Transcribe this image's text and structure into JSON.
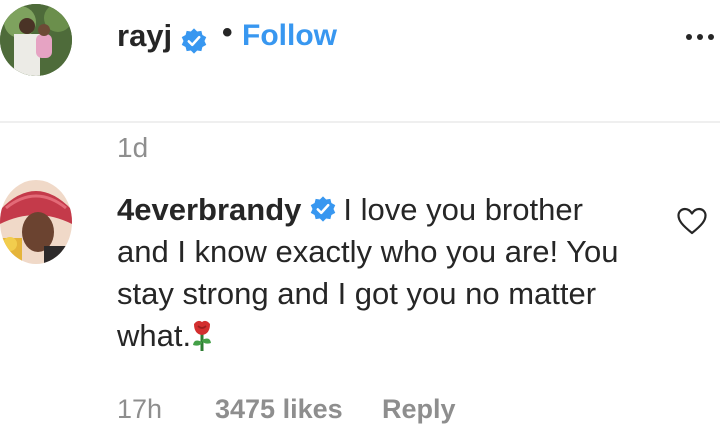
{
  "header": {
    "username": "rayj",
    "separator": "•",
    "follow_label": "Follow"
  },
  "post": {
    "age": "1d"
  },
  "comment": {
    "username": "4everbrandy",
    "text": "I love you brother and I know exactly who you are! You stay strong and I got you no matter what.",
    "time": "17h",
    "likes": "3475 likes",
    "reply_label": "Reply"
  },
  "colors": {
    "link_blue": "#3897f0",
    "verified_blue": "#3897f0",
    "muted_gray": "#8e8e8e",
    "text_dark": "#262626"
  },
  "icons": [
    "verified-badge-icon",
    "more-options-icon",
    "heart-outline-icon",
    "rose-emoji-icon"
  ]
}
